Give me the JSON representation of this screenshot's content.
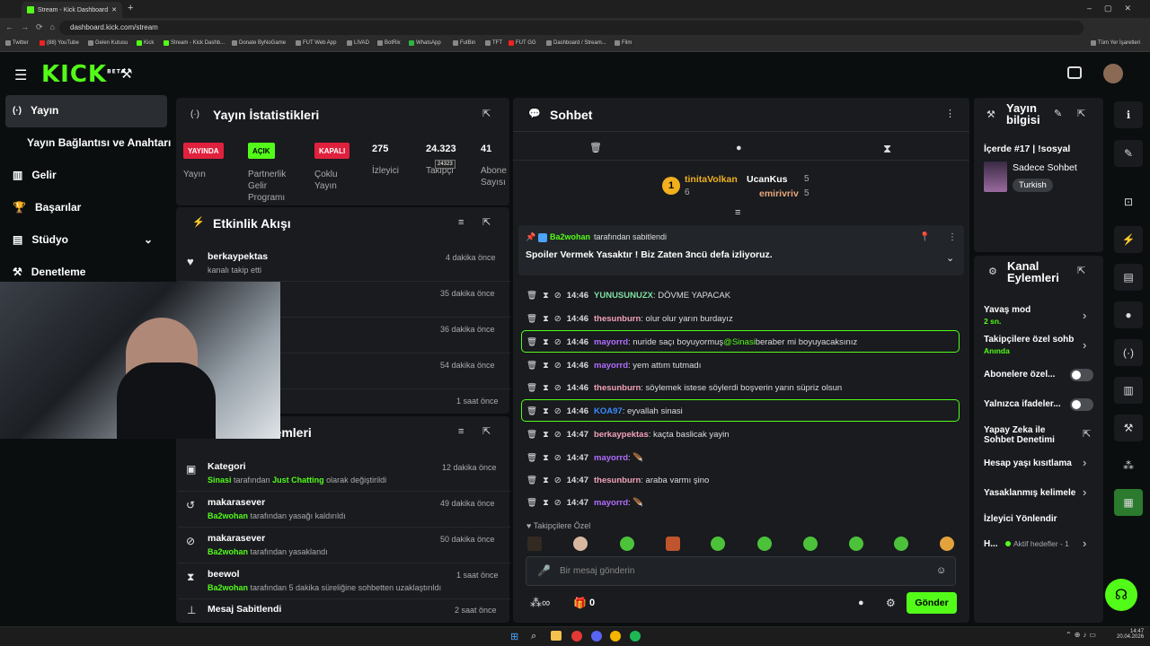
{
  "browser": {
    "tabs": [
      {
        "label": "Stream - Kick Dashboard",
        "close": "✕"
      }
    ],
    "new_tab": "+",
    "url": "dashboard.kick.com/stream",
    "bookmarks": [
      "Twitter",
      "(88) YouTube",
      "Gelen Kutusu",
      "Kick",
      "Stream - Kick Dashb...",
      "Donate ByNoGame",
      "FUT Web App",
      "LIVAD",
      "BotRix",
      "WhatsApp",
      "FutBin",
      "TFT",
      "FUT GG",
      "Dashboard / Stream...",
      "Film"
    ],
    "all_bookmarks": "Tüm Yer İşaretleri"
  },
  "sidebar": {
    "items": [
      {
        "label": "Yayın",
        "icon": "broadcast-icon"
      },
      {
        "label": "Yayın Bağlantısı ve Anahtarı"
      },
      {
        "label": "Gelir",
        "icon": "revenue-icon"
      },
      {
        "label": "Başarılar",
        "icon": "trophy-icon"
      },
      {
        "label": "Stüdyo",
        "icon": "studio-icon"
      },
      {
        "label": "Denetleme",
        "icon": "moderation-icon"
      }
    ]
  },
  "stats": {
    "title": "Yayın İstatistikleri",
    "status": [
      {
        "badge": "YAYINDA",
        "label": "Yayın",
        "color": "#e0213d"
      },
      {
        "badge": "AÇIK",
        "label": "Partnerlik Gelir Programı",
        "color": "#53fc18"
      },
      {
        "badge": "KAPALI",
        "label": "Çoklu Yayın",
        "color": "#e0213d"
      }
    ],
    "viewers": {
      "value": "275",
      "label": "İzleyici"
    },
    "followers": {
      "value": "24.323",
      "label": "Takipçi",
      "tooltip": "24323"
    },
    "subs": {
      "value": "41",
      "label": "Abone Sayısı"
    }
  },
  "activity": {
    "title": "Etkinlik Akışı",
    "items": [
      {
        "name": "berkaypektas",
        "desc": "kanalı takip etti",
        "time": "4 dakika önce"
      },
      {
        "name": "",
        "desc": "",
        "time": "35 dakika önce"
      },
      {
        "name": "",
        "desc": "",
        "time": "36 dakika önce"
      },
      {
        "name": "",
        "desc": "",
        "time": "54 dakika önce"
      },
      {
        "name": "",
        "desc": "",
        "time": "1 saat önce"
      }
    ]
  },
  "modlog": {
    "title": "...lemleri",
    "items": [
      {
        "name": "Kategori",
        "actor": "Sinasi",
        "mid": " tarafından ",
        "target": "Just Chatting",
        "rest": " olarak değiştirildi",
        "time": "12 dakika önce"
      },
      {
        "name": "makarasever",
        "actor": "Ba2wohan",
        "mid": " tarafından yasağı kaldırıldı",
        "target": "",
        "rest": "",
        "time": "49 dakika önce"
      },
      {
        "name": "makarasever",
        "actor": "Ba2wohan",
        "mid": " tarafından yasaklandı",
        "target": "",
        "rest": "",
        "time": "50 dakika önce"
      },
      {
        "name": "beewol",
        "actor": "Ba2wohan",
        "mid": " tarafından 5 dakika süreliğine sohbetten uzaklaştırıldı",
        "target": "",
        "rest": "",
        "time": "1 saat önce"
      },
      {
        "name": "Mesaj Sabitlendi",
        "actor": "",
        "mid": "",
        "target": "",
        "rest": "",
        "time": "2 saat önce"
      }
    ]
  },
  "chat": {
    "title": "Sohbet",
    "top_gifters": [
      {
        "name": "tinitaVolkan",
        "count": "6",
        "rank": "1"
      },
      {
        "name": "UcanKus",
        "count": "5"
      },
      {
        "name": "emirivriv",
        "count": "5"
      }
    ],
    "pinned": {
      "by": "Ba2wohan",
      "by_suffix": "tarafından sabitlendi",
      "text": "Spoiler Vermek Yasaktır ! Biz Zaten 3ncü defa izliyoruz."
    },
    "messages": [
      {
        "time": "14:46",
        "user": "YUNUSUNUZX",
        "color": "#7ee0a0",
        "text": ": DÖVME YAPACAK",
        "highlight": false
      },
      {
        "time": "14:46",
        "user": "thesunburn",
        "color": "#f2a1b8",
        "text": ": olur olur yarın burdayız",
        "highlight": false
      },
      {
        "time": "14:46",
        "user": "mayorrd",
        "color": "#b36cff",
        "text": ": nuride saçı boyuyormuş ",
        "mention": "@Sinasi",
        "text2": " beraber mi boyuyacaksınız",
        "highlight": true
      },
      {
        "time": "14:46",
        "user": "mayorrd",
        "color": "#b36cff",
        "text": ": yem attım tutmadı",
        "highlight": false
      },
      {
        "time": "14:46",
        "user": "thesunburn",
        "color": "#f2a1b8",
        "text": ": söylemek istese söylerdi boşverin yarın süpriz olsun",
        "highlight": false
      },
      {
        "time": "14:46",
        "user": "KOA97",
        "color": "#3a8bff",
        "text": ": eyvallah sinasi",
        "highlight": true
      },
      {
        "time": "14:47",
        "user": "berkaypektas",
        "color": "#f2a1b8",
        "text": ": kaçta baslicak yayin",
        "highlight": false
      },
      {
        "time": "14:47",
        "user": "mayorrd",
        "color": "#b36cff",
        "text": ": 🪶",
        "highlight": false
      },
      {
        "time": "14:47",
        "user": "thesunburn",
        "color": "#f2a1b8",
        "text": ": araba varmı şino",
        "highlight": false
      },
      {
        "time": "14:47",
        "user": "mayorrd",
        "color": "#b36cff",
        "text": ": 🪶",
        "highlight": false
      }
    ],
    "followers_only": "Takipçilere Özel",
    "placeholder": "Bir mesaj gönderin",
    "infinity": "∞",
    "gift_count": "0",
    "send": "Gönder"
  },
  "stream_info": {
    "title": "Yayın bilgisi",
    "stream_title": "İçerde #17 | !sosyal",
    "category": "Sadece Sohbet",
    "language": "Turkish"
  },
  "channel_actions": {
    "title": "Kanal Eylemleri",
    "slow_mode": {
      "label": "Yavaş mod",
      "value": "2 sn."
    },
    "followers_chat": {
      "label": "Takipçilere özel sohb",
      "value": "Anında"
    },
    "subs_only": "Abonelere özel...",
    "emotes_only": "Yalnızca ifadeler...",
    "ai_mod": "Yapay Zeka ile Sohbet Denetimi",
    "account_age": "Hesap yaşı kısıtlama",
    "banned_words": "Yasaklanmış kelimele",
    "viewer_redirect": "İzleyici Yönlendir",
    "goals": {
      "label": "H...",
      "value": "Aktif hedefler - 1"
    }
  },
  "taskbar": {
    "time": "14:47",
    "date": "20.04.2026"
  },
  "colors": {
    "accent": "#53fc18",
    "live": "#e0213d",
    "panel": "#191b1f",
    "bg": "#0b0e0f"
  }
}
